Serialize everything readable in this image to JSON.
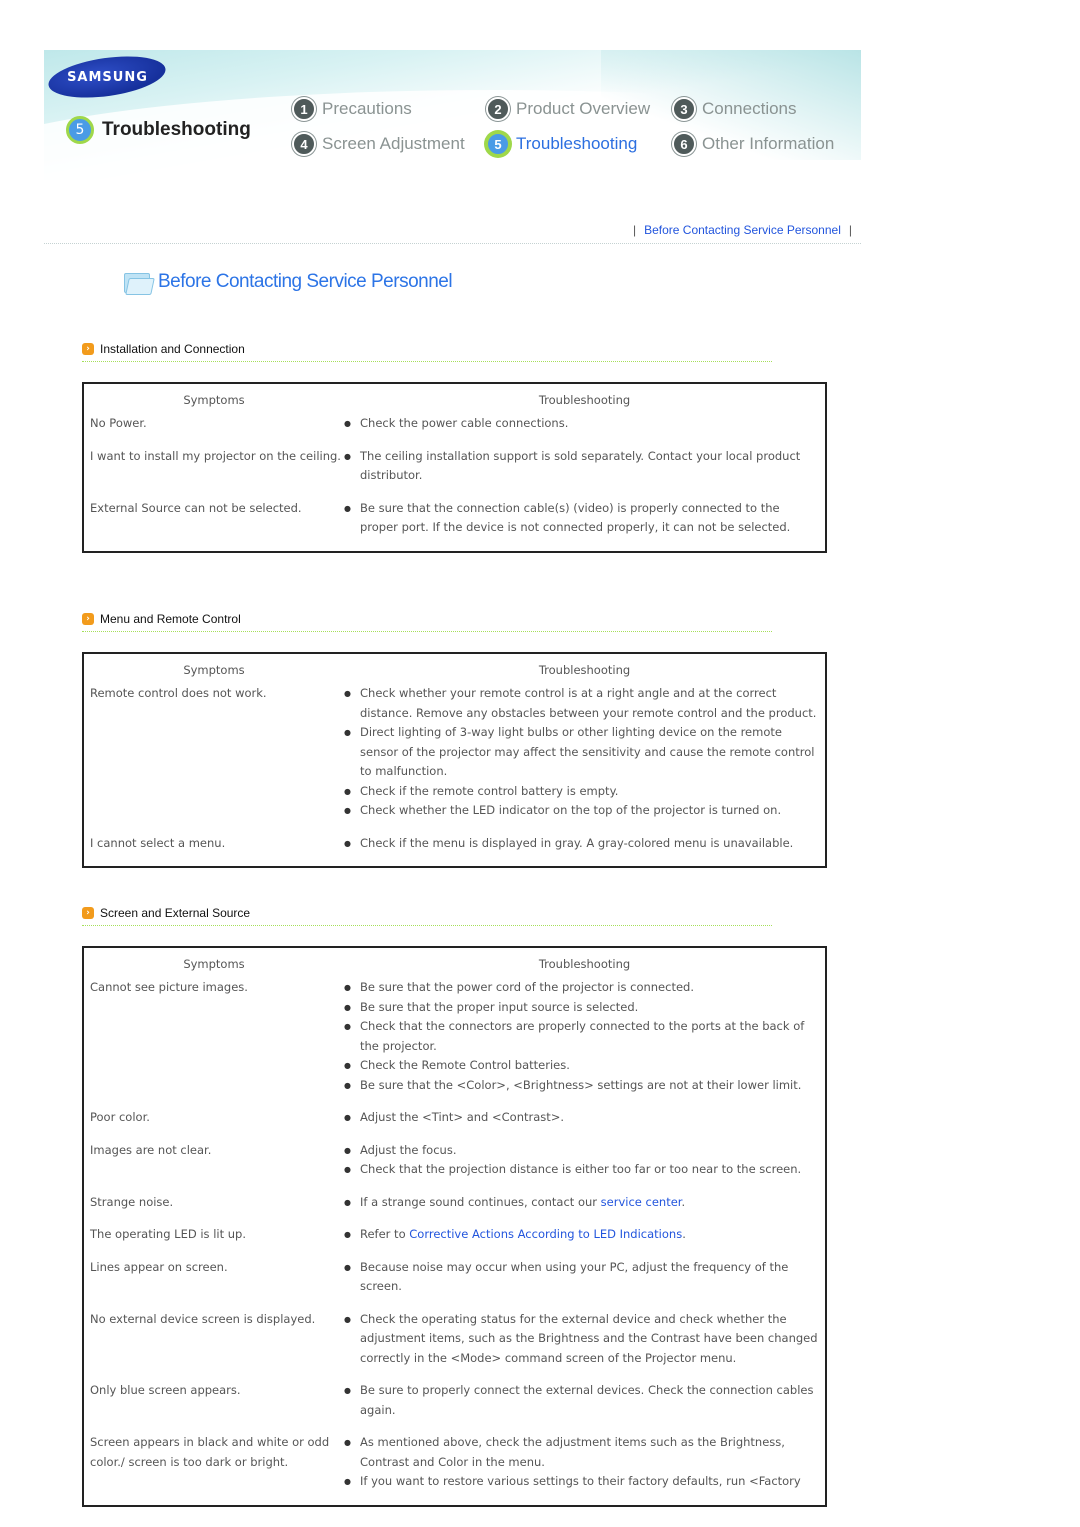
{
  "header": {
    "logo": "SAMSUNG",
    "current_section": {
      "number": "5",
      "label": "Troubleshooting"
    },
    "nav": [
      {
        "number": "1",
        "label": "Precautions",
        "active": false
      },
      {
        "number": "2",
        "label": "Product Overview",
        "active": false
      },
      {
        "number": "3",
        "label": "Connections",
        "active": false
      },
      {
        "number": "4",
        "label": "Screen Adjustment",
        "active": false
      },
      {
        "number": "5",
        "label": "Troubleshooting",
        "active": true
      },
      {
        "number": "6",
        "label": "Other Information",
        "active": false
      }
    ]
  },
  "breadcrumb": {
    "sep": "|",
    "link": "Before Contacting Service Personnel"
  },
  "page_title": "Before Contacting Service Personnel",
  "colors": {
    "accent_blue": "#2c74e6",
    "link": "#2255dd",
    "section_arrow": "#f29b1c",
    "rule_green": "#a6e05a"
  },
  "sections": [
    {
      "title": "Installation and Connection",
      "headers": [
        "Symptoms",
        "Troubleshooting"
      ],
      "rows": [
        {
          "symptom": "No Power.",
          "fixes": [
            "Check the power cable connections."
          ]
        },
        {
          "symptom": "I want to install my projector on the ceiling.",
          "fixes": [
            "The ceiling installation support is sold separately. Contact your local product distributor."
          ]
        },
        {
          "symptom": "External Source can not be selected.",
          "fixes": [
            "Be sure that the connection cable(s) (video) is properly connected to the proper port. If the device is not connected properly, it can not be selected."
          ]
        }
      ]
    },
    {
      "title": "Menu and Remote Control",
      "headers": [
        "Symptoms",
        "Troubleshooting"
      ],
      "rows": [
        {
          "symptom": "Remote control does not work.",
          "fixes": [
            "Check whether your remote control is at a right angle and at the correct distance. Remove any obstacles between your remote control and the product.",
            "Direct lighting of 3-way light bulbs or other lighting device on the remote sensor of the projector may affect the sensitivity and cause the remote control to malfunction.",
            "Check if the remote control battery is empty.",
            "Check whether the LED indicator on the top of the projector is turned on."
          ]
        },
        {
          "symptom": "I cannot select a menu.",
          "fixes": [
            "Check if the menu is displayed in gray. A gray-colored menu is unavailable."
          ]
        }
      ]
    },
    {
      "title": "Screen and External Source",
      "headers": [
        "Symptoms",
        "Troubleshooting"
      ],
      "rows": [
        {
          "symptom": "Cannot see picture images.",
          "fixes": [
            "Be sure that the power cord of the projector is connected.",
            "Be sure that the proper input source is selected.",
            "Check that the connectors are properly connected to the ports at the back of the projector.",
            "Check the Remote Control batteries.",
            "Be sure that the <Color>, <Brightness> settings are not at their lower limit."
          ]
        },
        {
          "symptom": "Poor color.",
          "fixes": [
            "Adjust the <Tint> and <Contrast>."
          ]
        },
        {
          "symptom": "Images are not clear.",
          "fixes": [
            "Adjust the focus.",
            "Check that the projection distance is either too far or too near to the screen."
          ]
        },
        {
          "symptom": "Strange noise.",
          "fixes": [
            {
              "pre": "If a strange sound continues, contact our ",
              "link": "service center",
              "post": "."
            }
          ]
        },
        {
          "symptom": "The operating LED is lit up.",
          "fixes": [
            {
              "pre": "Refer to ",
              "link": "Corrective Actions According to LED Indications",
              "post": "."
            }
          ]
        },
        {
          "symptom": "Lines appear on screen.",
          "fixes": [
            "Because noise may occur when using your PC, adjust the frequency of the screen."
          ]
        },
        {
          "symptom": "No external device screen is displayed.",
          "fixes": [
            "Check the operating status for the external device and check whether the adjustment items, such as the Brightness and the Contrast have been changed correctly in the <Mode> command screen of the Projector menu."
          ]
        },
        {
          "symptom": "Only blue screen appears.",
          "fixes": [
            "Be sure to properly connect the external devices. Check the connection cables again."
          ]
        },
        {
          "symptom": "Screen appears in black and white or odd color./ screen is too dark or bright.",
          "fixes": [
            "As mentioned above, check the adjustment items such as the Brightness, Contrast and Color in the menu.",
            "If you want to restore various settings to their factory defaults, run <Factory"
          ]
        }
      ]
    }
  ]
}
